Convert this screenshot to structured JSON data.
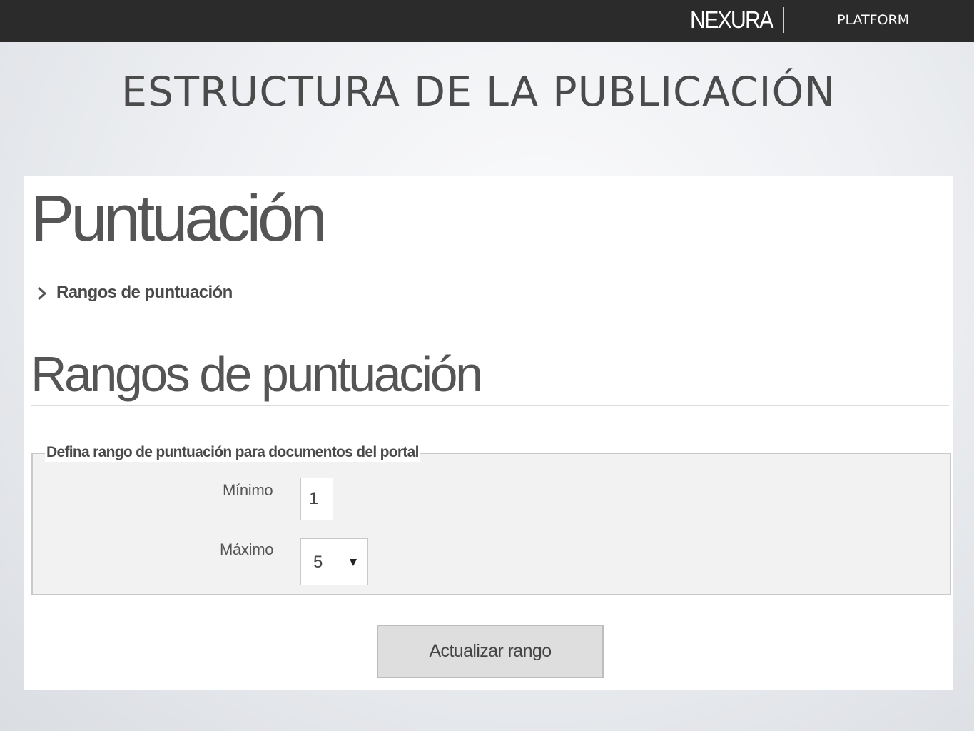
{
  "header": {
    "brand": "NEXURA",
    "platform": "PLATFORM"
  },
  "slide": {
    "title": "ESTRUCTURA DE LA PUBLICACIÓN"
  },
  "screen": {
    "page_heading": "Puntuación",
    "breadcrumb": {
      "icon": "chevron-right-icon",
      "label": "Rangos de puntuación"
    },
    "section_heading": "Rangos de puntuación",
    "form": {
      "legend": "Defina rango de puntuación para documentos del portal",
      "min_label": "Mínimo",
      "min_value": "1",
      "max_label": "Máximo",
      "max_value": "5",
      "submit_label": "Actualizar rango"
    }
  }
}
